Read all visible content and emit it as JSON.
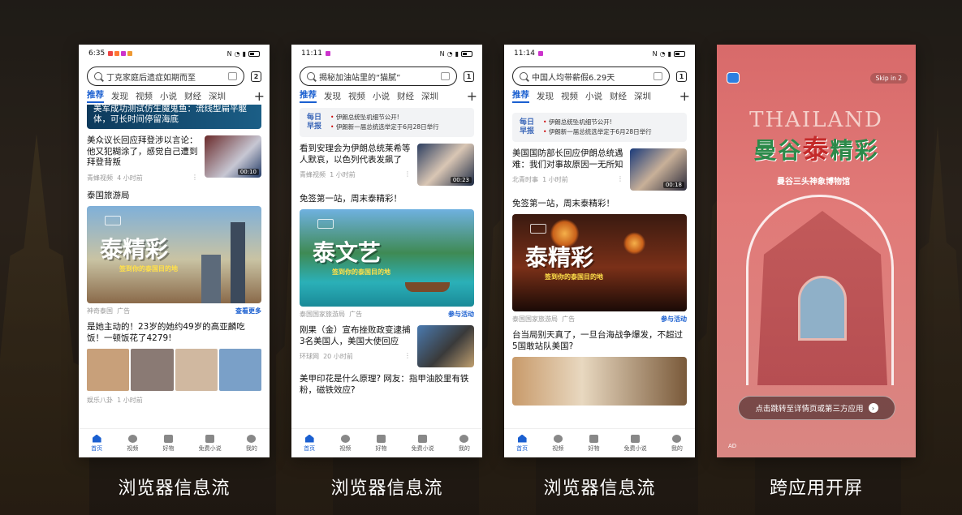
{
  "captions": [
    "浏览器信息流",
    "浏览器信息流",
    "浏览器信息流",
    "跨应用开屏"
  ],
  "phones": [
    {
      "time": "6:35",
      "search_query": "丁克家庭后遗症如期而至",
      "tab_count": "2",
      "tabs": [
        "推荐",
        "发现",
        "视频",
        "小说",
        "财经",
        "深圳"
      ],
      "top_fragment": "美军成功测试仿生魔鬼鱼：流线型扁平躯体，可长时间停留海底",
      "news1": {
        "title": "美众议长回应拜登涉以言论：他又犯糊涂了，感觉自己遭到拜登背叛",
        "source": "青蜂视频",
        "time": "4 小时前",
        "duration": "00:10"
      },
      "ad": {
        "title": "泰国旅游局",
        "headline": "泰精彩",
        "slogan": "签到你的泰国目的地",
        "advertiser": "神奇泰国",
        "label": "广告",
        "cta": "查看更多"
      },
      "news2": {
        "title": "是她主动的！23岁的她约49岁的高亚麟吃饭！一顿饭花了4279!",
        "source": "娱乐八卦",
        "time": "1 小时前"
      }
    },
    {
      "time": "11:11",
      "search_query": "揭秘加油站里的“猫腻”",
      "tab_count": "1",
      "tabs": [
        "推荐",
        "发现",
        "视频",
        "小说",
        "财经",
        "深圳"
      ],
      "daily_badge": "每日早报",
      "daily_items": [
        "伊朗总统坠机细节公开!",
        "伊朗新一届总统选举定于6月28日举行"
      ],
      "news1": {
        "title": "看到安理会为伊朗总统莱希等人默哀，以色列代表发飙了",
        "source": "青蜂视频",
        "time": "1 小时前",
        "duration": "00:23"
      },
      "ad": {
        "title": "免签第一站，周末泰精彩！",
        "headline": "泰文艺",
        "slogan": "签到你的泰国目的地",
        "advertiser": "泰国国家旅游局",
        "label": "广告",
        "cta": "参与活动"
      },
      "news2": {
        "title": "刚果（金）宣布挫败政变逮捕3名美国人，美国大使回应",
        "source": "环球网",
        "time": "20 小时前"
      },
      "news3": {
        "title": "美甲印花是什么原理? 网友：指甲油胶里有铁粉，磁铁效应?"
      }
    },
    {
      "time": "11:14",
      "search_query": "中国人均带薪假6.29天",
      "tab_count": "1",
      "tabs": [
        "推荐",
        "发现",
        "视频",
        "小说",
        "财经",
        "深圳"
      ],
      "daily_badge": "每日早报",
      "daily_items": [
        "伊朗总统坠机细节公开!",
        "伊朗新一届总统选举定于6月28日举行"
      ],
      "news1": {
        "title": "美国国防部长回应伊朗总统遇难：我们对事故原因一无所知",
        "source": "北青时事",
        "time": "1 小时前",
        "duration": "00:18"
      },
      "ad": {
        "title": "免签第一站，周末泰精彩！",
        "headline": "泰精彩",
        "slogan": "签到你的泰国目的地",
        "advertiser": "泰国国家旅游局",
        "label": "广告",
        "cta": "参与活动"
      },
      "news2": {
        "title": "台当局别天真了，一旦台海战争爆发，不超过5国敢站队美国?"
      }
    }
  ],
  "bottom_nav": [
    "首页",
    "视频",
    "好物",
    "免费小说",
    "我的"
  ],
  "splash": {
    "skip": "Skip in 2",
    "brand_en": "THAILAND",
    "brand_cn_left": "曼谷",
    "brand_cn_mid": "泰",
    "brand_cn_right": "精彩",
    "subtitle": "曼谷三头神象博物馆",
    "cta": "点击跳转至详情页或第三方应用",
    "ad_tag": "AD"
  },
  "colors": {
    "accent": "#1a5fd0",
    "splash_bg": "#d86a6a"
  }
}
